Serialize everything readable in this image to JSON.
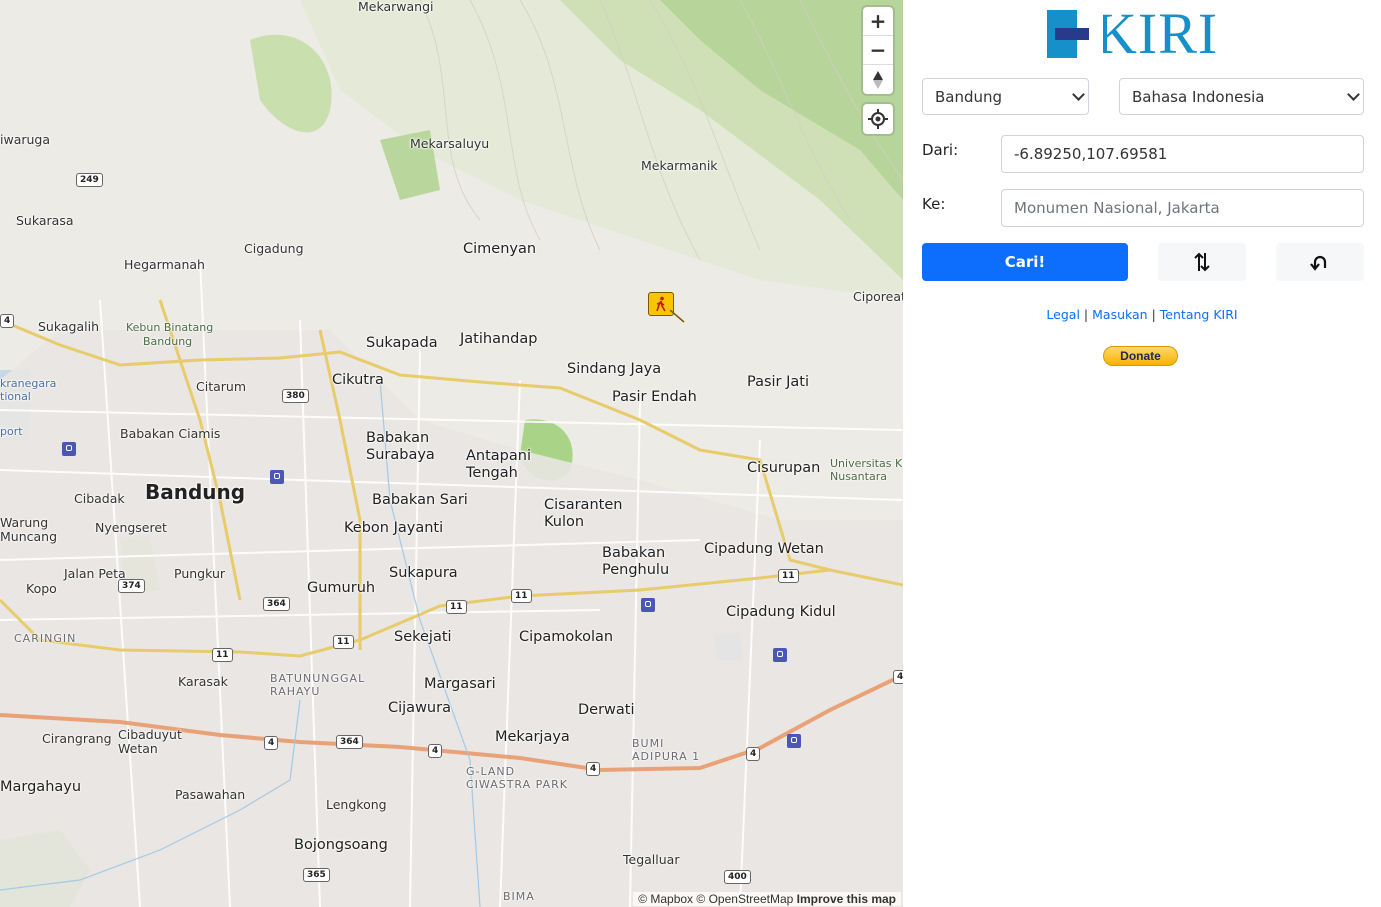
{
  "map": {
    "places": [
      {
        "id": "mekarwangi",
        "text": "Mekarwangi",
        "size": "sm"
      },
      {
        "id": "iwaruga",
        "text": "iwaruga",
        "size": "sm"
      },
      {
        "id": "mekarsaluyu",
        "text": "Mekarsaluyu",
        "size": "sm"
      },
      {
        "id": "mekarmanik",
        "text": "Mekarmanik",
        "size": "sm"
      },
      {
        "id": "sukarasa",
        "text": "Sukarasa",
        "size": "sm"
      },
      {
        "id": "cigadung",
        "text": "Cigadung",
        "size": "sm"
      },
      {
        "id": "cimenyan",
        "text": "Cimenyan",
        "size": "mid"
      },
      {
        "id": "hegarmanah",
        "text": "Hegarmanah",
        "size": "sm"
      },
      {
        "id": "ciporeat",
        "text": "Ciporeat",
        "size": "sm"
      },
      {
        "id": "sukagalih",
        "text": "Sukagalih",
        "size": "sm"
      },
      {
        "id": "kebun-binatang",
        "text": "Kebun Binatang",
        "size": "green"
      },
      {
        "id": "kebun-binatang-2",
        "text": "Bandung",
        "size": "green"
      },
      {
        "id": "sukapada",
        "text": "Sukapada",
        "size": "mid"
      },
      {
        "id": "jatihandap",
        "text": "Jatihandap",
        "size": "mid"
      },
      {
        "id": "sindang-jaya",
        "text": "Sindang Jaya",
        "size": "mid"
      },
      {
        "id": "citarum",
        "text": "Citarum",
        "size": "sm"
      },
      {
        "id": "cikutra",
        "text": "Cikutra",
        "size": "mid"
      },
      {
        "id": "pasir-jati",
        "text": "Pasir Jati",
        "size": "mid"
      },
      {
        "id": "pasir-endah",
        "text": "Pasir Endah",
        "size": "mid"
      },
      {
        "id": "kranegara",
        "text": "kranegara",
        "size": "area-blue"
      },
      {
        "id": "tional",
        "text": "tional",
        "size": "area-blue"
      },
      {
        "id": "port",
        "text": "port",
        "size": "area-blue"
      },
      {
        "id": "babakan-ciamis",
        "text": "Babakan Ciamis",
        "size": "sm"
      },
      {
        "id": "babakan-surabaya",
        "text": "Babakan\nSurabaya",
        "size": "mid"
      },
      {
        "id": "antapani-tengah",
        "text": "Antapani\nTengah",
        "size": "mid"
      },
      {
        "id": "cisurupan",
        "text": "Cisurupan",
        "size": "mid"
      },
      {
        "id": "universitas",
        "text": "Universitas Kr\nNusantara",
        "size": "green"
      },
      {
        "id": "bandung",
        "text": "Bandung",
        "size": "big"
      },
      {
        "id": "cibadak",
        "text": "Cibadak",
        "size": "sm"
      },
      {
        "id": "babakan-sari",
        "text": "Babakan Sari",
        "size": "mid"
      },
      {
        "id": "cisaranten-kulon",
        "text": "Cisaranten\nKulon",
        "size": "mid"
      },
      {
        "id": "warung-muncang",
        "text": "Warung\nMuncang",
        "size": "sm"
      },
      {
        "id": "nyengseret",
        "text": "Nyengseret",
        "size": "sm"
      },
      {
        "id": "kebon-jayanti",
        "text": "Kebon Jayanti",
        "size": "mid"
      },
      {
        "id": "babakan-penghulu",
        "text": "Babakan\nPenghulu",
        "size": "mid"
      },
      {
        "id": "cipadung-wetan",
        "text": "Cipadung Wetan",
        "size": "mid"
      },
      {
        "id": "jalan-peta",
        "text": "Jalan Peta",
        "size": "sm"
      },
      {
        "id": "pungkur",
        "text": "Pungkur",
        "size": "sm"
      },
      {
        "id": "sukapura",
        "text": "Sukapura",
        "size": "mid"
      },
      {
        "id": "kopo",
        "text": "Kopo",
        "size": "sm"
      },
      {
        "id": "gumuruh",
        "text": "Gumuruh",
        "size": "mid"
      },
      {
        "id": "cipadung-kidul",
        "text": "Cipadung Kidul",
        "size": "mid"
      },
      {
        "id": "caringin",
        "text": "CARINGIN",
        "size": "area"
      },
      {
        "id": "sekejati",
        "text": "Sekejati",
        "size": "mid"
      },
      {
        "id": "cipamokolan",
        "text": "Cipamokolan",
        "size": "mid"
      },
      {
        "id": "karasak",
        "text": "Karasak",
        "size": "sm"
      },
      {
        "id": "batununggal",
        "text": "BATUNUNGGAL\nRAHAYU",
        "size": "area"
      },
      {
        "id": "margasari",
        "text": "Margasari",
        "size": "mid"
      },
      {
        "id": "cijawura",
        "text": "Cijawura",
        "size": "mid"
      },
      {
        "id": "derwati",
        "text": "Derwati",
        "size": "mid"
      },
      {
        "id": "cirangrang",
        "text": "Cirangrang",
        "size": "sm"
      },
      {
        "id": "cibaduyut-wetan",
        "text": "Cibaduyut\nWetan",
        "size": "sm"
      },
      {
        "id": "mekarjaya",
        "text": "Mekarjaya",
        "size": "mid"
      },
      {
        "id": "bumi-adipura",
        "text": "BUMI\nADIPURA 1",
        "size": "area"
      },
      {
        "id": "g-land",
        "text": "G-LAND\nCIWASTRA PARK",
        "size": "area"
      },
      {
        "id": "margahayu",
        "text": "Margahayu",
        "size": "mid"
      },
      {
        "id": "pasawahan",
        "text": "Pasawahan",
        "size": "sm"
      },
      {
        "id": "lengkong",
        "text": "Lengkong",
        "size": "sm"
      },
      {
        "id": "bojongsoang",
        "text": "Bojongsoang",
        "size": "mid"
      },
      {
        "id": "tegalluar",
        "text": "Tegalluar",
        "size": "sm"
      },
      {
        "id": "bima",
        "text": "BIMA",
        "size": "area"
      }
    ],
    "shields": [
      "249",
      "4",
      "380",
      "374",
      "364",
      "11",
      "11",
      "11",
      "11",
      "11",
      "4",
      "364",
      "4",
      "4",
      "4",
      "365",
      "400",
      "4"
    ],
    "attribution": {
      "mapbox": "© Mapbox",
      "osm": "© OpenStreetMap",
      "improve": "Improve this map"
    }
  },
  "panel": {
    "logo_text": "KIRI",
    "city_select": {
      "value": "Bandung",
      "options": [
        "Bandung"
      ]
    },
    "language_select": {
      "value": "Bahasa Indonesia",
      "options": [
        "Bahasa Indonesia"
      ]
    },
    "from_label": "Dari:",
    "from_value": "-6.89250,107.69581",
    "to_label": "Ke:",
    "to_placeholder": "Monumen Nasional, Jakarta",
    "search_button": "Cari!",
    "links": {
      "legal": "Legal",
      "sep1": "|",
      "masukan": "Masukan",
      "sep2": "|",
      "tentang": "Tentang KIRI"
    },
    "donate": "Donate"
  }
}
